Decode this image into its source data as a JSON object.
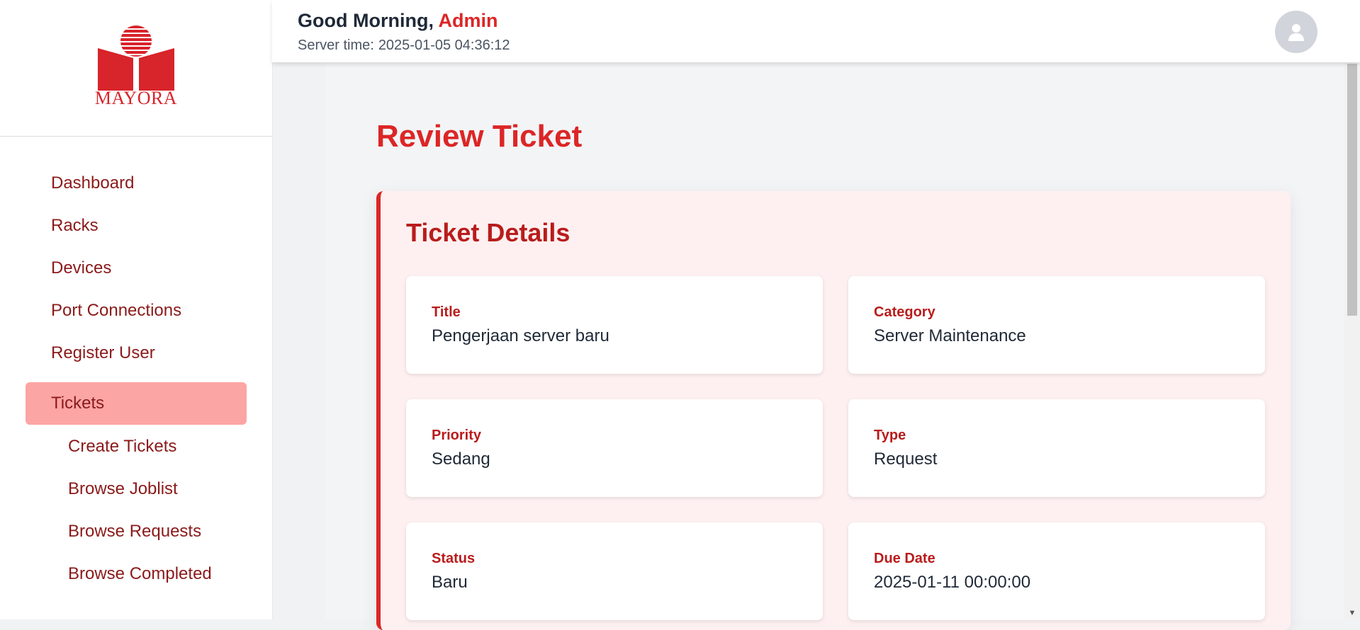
{
  "brand": {
    "name": "MAYORA",
    "color": "#dc2626"
  },
  "sidebar": {
    "items": [
      {
        "label": "Dashboard"
      },
      {
        "label": "Racks"
      },
      {
        "label": "Devices"
      },
      {
        "label": "Port Connections"
      },
      {
        "label": "Register User"
      },
      {
        "label": "Tickets",
        "active": true
      },
      {
        "label": "Create Tickets",
        "sub": true
      },
      {
        "label": "Browse Joblist",
        "sub": true
      },
      {
        "label": "Browse Requests",
        "sub": true
      },
      {
        "label": "Browse Completed",
        "sub": true
      }
    ]
  },
  "header": {
    "greeting": "Good Morning,",
    "user_name": "Admin",
    "server_time_label": "Server time:",
    "server_time": "2025-01-05 04:36:12",
    "avatar_icon": "user-icon"
  },
  "main": {
    "title": "Review Ticket",
    "details": {
      "heading": "Ticket Details",
      "fields": [
        {
          "label": "Title",
          "value": "Pengerjaan server baru"
        },
        {
          "label": "Category",
          "value": "Server Maintenance"
        },
        {
          "label": "Priority",
          "value": "Sedang"
        },
        {
          "label": "Type",
          "value": "Request"
        },
        {
          "label": "Status",
          "value": "Baru"
        },
        {
          "label": "Due Date",
          "value": "2025-01-11 00:00:00"
        }
      ]
    }
  }
}
